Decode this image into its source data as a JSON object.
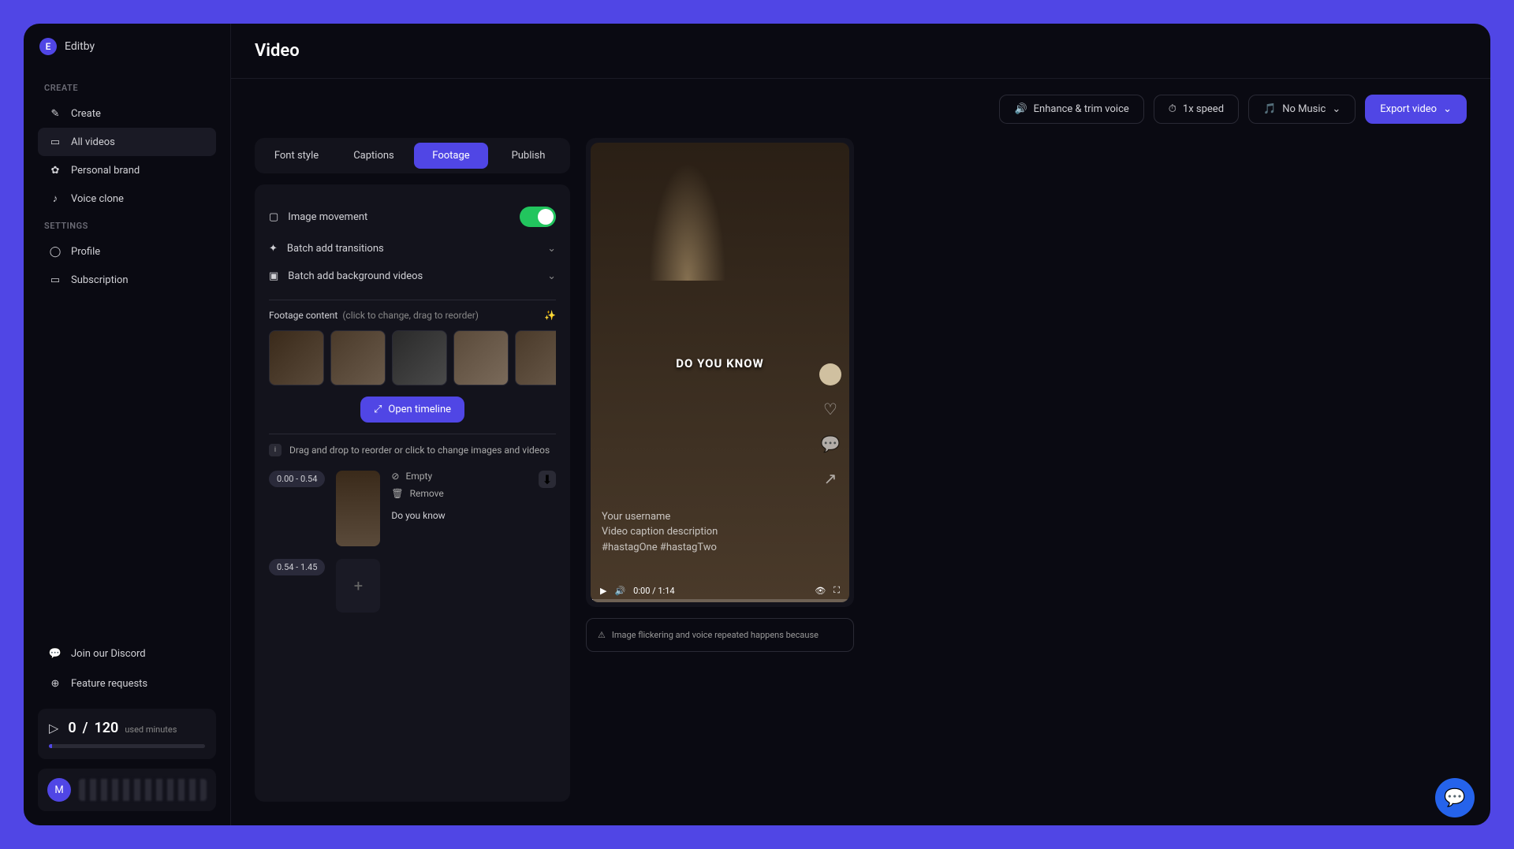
{
  "app": {
    "logo_letter": "E",
    "logo_name": "Editby"
  },
  "sidebar": {
    "create_label": "CREATE",
    "settings_label": "SETTINGS",
    "items_create": [
      {
        "label": "Create"
      },
      {
        "label": "All videos"
      },
      {
        "label": "Personal brand"
      },
      {
        "label": "Voice clone"
      }
    ],
    "items_settings": [
      {
        "label": "Profile"
      },
      {
        "label": "Subscription"
      }
    ],
    "discord": "Join our Discord",
    "feature_requests": "Feature requests",
    "usage": {
      "current": "0",
      "sep": "/",
      "total": "120",
      "label": "used minutes"
    },
    "user_letter": "M"
  },
  "header": {
    "title": "Video"
  },
  "toolbar": {
    "enhance": "Enhance & trim voice",
    "speed": "1x speed",
    "music_prefix": "🎵",
    "music": "No Music",
    "export": "Export video"
  },
  "tabs": [
    "Font style",
    "Captions",
    "Footage",
    "Publish"
  ],
  "panel": {
    "image_movement": "Image movement",
    "transitions": "Batch add transitions",
    "backgrounds": "Batch add background videos",
    "footage_label": "Footage content",
    "footage_hint": "(click to change, drag to reorder)",
    "open_timeline": "Open timeline",
    "reorder_hint": "Drag and drop to reorder or click to change images and videos",
    "clips": [
      {
        "time": "0.00 - 0.54",
        "empty": "Empty",
        "remove": "Remove",
        "text": "Do you know"
      },
      {
        "time": "0.54 - 1.45"
      }
    ]
  },
  "preview": {
    "caption": "DO YOU KNOW",
    "username": "Your username",
    "description": "Video caption description",
    "hashtags": "#hastagOne #hastagTwo",
    "time": "0:00 / 1:14",
    "warning": "Image flickering and voice repeated happens because"
  },
  "colors": {
    "accent": "#5046e5",
    "success": "#22c55e"
  }
}
